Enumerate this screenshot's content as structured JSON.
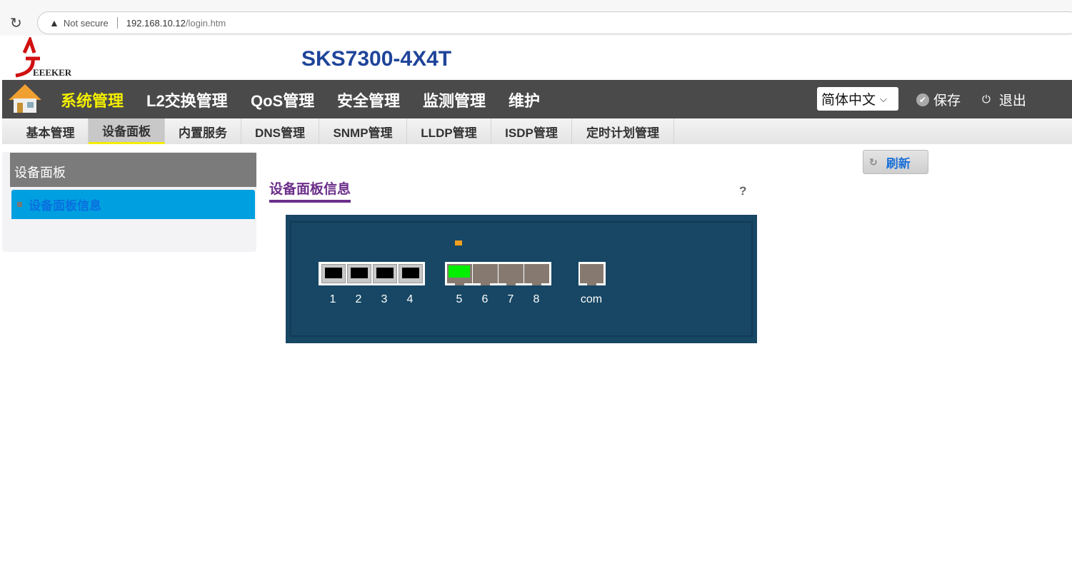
{
  "browser": {
    "security": "Not secure",
    "url_host": "192.168.10.12",
    "url_path": "/login.htm"
  },
  "header": {
    "title": "SKS7300-4X4T",
    "logo_text": "SEEKER"
  },
  "nav": {
    "items": [
      "系统管理",
      "L2交换管理",
      "QoS管理",
      "安全管理",
      "监测管理",
      "维护"
    ],
    "active": 0,
    "language": "简体中文",
    "save": "保存",
    "logout": "退出"
  },
  "subnav": {
    "tabs": [
      "基本管理",
      "设备面板",
      "内置服务",
      "DNS管理",
      "SNMP管理",
      "LLDP管理",
      "ISDP管理",
      "定时计划管理"
    ],
    "active": 1
  },
  "sidebar": {
    "title": "设备面板",
    "items": [
      "设备面板信息"
    ]
  },
  "content": {
    "title": "设备面板信息",
    "help": "?",
    "refresh": "刷新"
  },
  "panel": {
    "sfp_ports": [
      {
        "label": "1",
        "status": "down"
      },
      {
        "label": "2",
        "status": "down"
      },
      {
        "label": "3",
        "status": "down"
      },
      {
        "label": "4",
        "status": "down"
      }
    ],
    "rj45_ports": [
      {
        "label": "5",
        "status": "up"
      },
      {
        "label": "6",
        "status": "down"
      },
      {
        "label": "7",
        "status": "down"
      },
      {
        "label": "8",
        "status": "down"
      }
    ],
    "console": {
      "label": "com"
    },
    "colors": {
      "link_up": "#00ee00",
      "port_down": "#867a70",
      "led": "#f0a020",
      "panel": "#174764"
    }
  }
}
